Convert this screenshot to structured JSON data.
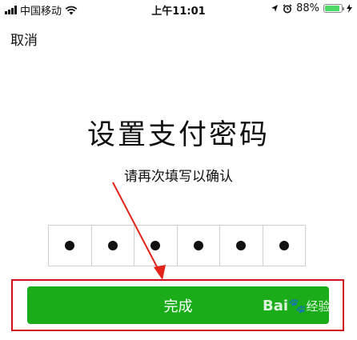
{
  "status_bar": {
    "carrier": "中国移动",
    "time": "上午11:01",
    "battery": "88%",
    "battery_level": 0.88
  },
  "nav": {
    "cancel_label": "取消"
  },
  "main": {
    "title": "设置支付密码",
    "subtitle": "请再次填写以确认",
    "pin_dots_filled": 6
  },
  "actions": {
    "done_label": "完成"
  },
  "annotation": {
    "highlight_color": "#d0111b"
  },
  "watermark": {
    "brand": "Bai",
    "suffix": "经验"
  }
}
